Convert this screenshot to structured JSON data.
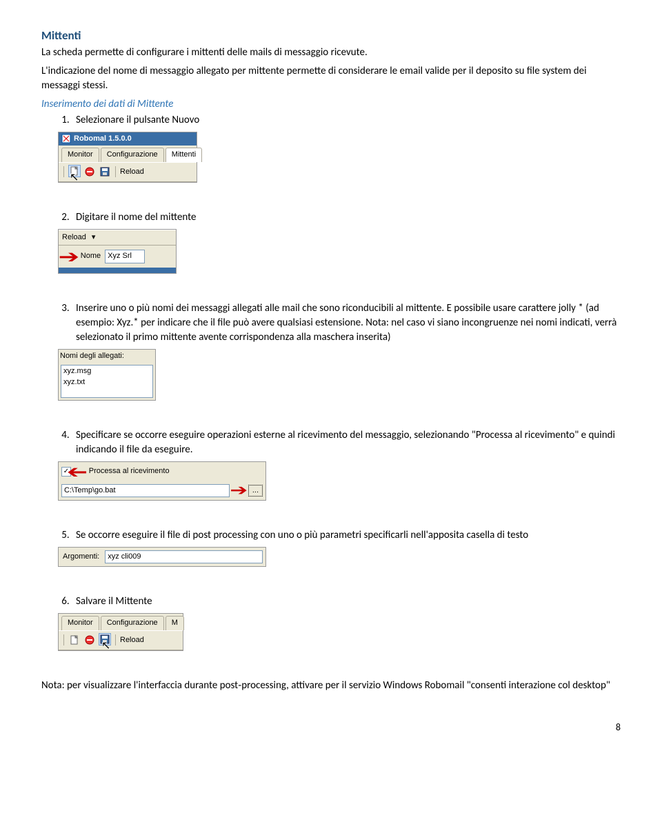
{
  "title": "Mittenti",
  "intro_p1": "La scheda permette di configurare i mittenti delle mails di messaggio ricevute.",
  "intro_p2": "L'indicazione del nome di messaggio allegato per mittente permette di considerare le email valide per il deposito su file system dei messaggi stessi.",
  "subheading": "Inserimento dei dati di Mittente",
  "steps": {
    "s1": "Selezionare il pulsante Nuovo",
    "s2": "Digitare il nome del mittente",
    "s3": "Inserire uno o più nomi dei messaggi allegati alle mail che sono riconducibili al mittente. E possibile usare carattere jolly * (ad esempio: Xyz.* per indicare che il file può avere qualsiasi estensione. Nota: nel caso vi siano incongruenze nei nomi indicati, verrà selezionato il primo mittente avente corrispondenza alla maschera inserita)",
    "s4": "Specificare se occorre eseguire operazioni esterne al ricevimento del messaggio, selezionando \"Processa al ricevimento\" e quindi indicando il file da eseguire.",
    "s5": "Se occorre eseguire il file di post processing con uno o più parametri specificarli nell'apposita casella di testo",
    "s6": "Salvare il Mittente"
  },
  "ui": {
    "app_title": "Robomal 1.5.0.0",
    "tab_monitor": "Monitor",
    "tab_config": "Configurazione",
    "tab_config_short": "M",
    "tab_mittenti": "Mittenti",
    "reload": "Reload",
    "nome_label": "Nome",
    "nome_value": "Xyz Srl",
    "allegati_label": "Nomi degli allegati:",
    "allegati_v1": "xyz.msg",
    "allegati_v2": "xyz.txt",
    "processa_label": "Processa al ricevimento",
    "path_value": "C:\\Temp\\go.bat",
    "argomenti_label": "Argomenti:",
    "argomenti_value": "xyz cli009",
    "dots": "..."
  },
  "footer_note": "Nota: per  visualizzare l'interfaccia durante post‑processing, attivare per il servizio Windows Robomail  \"consenti interazione col desktop\"",
  "page_number": "8"
}
